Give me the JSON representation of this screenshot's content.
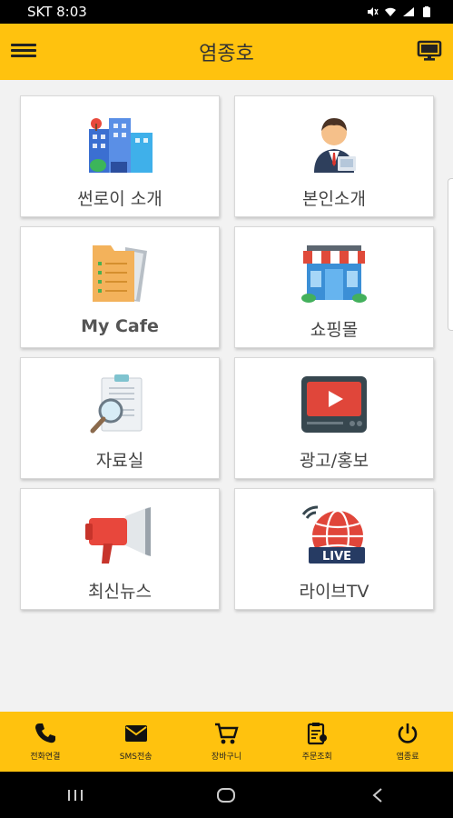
{
  "status": {
    "carrier_time": "SKT 8:03",
    "right": "4"
  },
  "app": {
    "title": "염종호"
  },
  "icons": {
    "menu": "menu-icon",
    "monitor": "monitor-icon"
  },
  "cards": [
    {
      "label": "썬로이 소개",
      "icon": "buildings-icon"
    },
    {
      "label": "본인소개",
      "icon": "businessman-icon"
    },
    {
      "label": "My Cafe",
      "icon": "folder-icon"
    },
    {
      "label": "쇼핑몰",
      "icon": "shop-icon"
    },
    {
      "label": "자료실",
      "icon": "document-search-icon"
    },
    {
      "label": "광고/홍보",
      "icon": "video-tv-icon"
    },
    {
      "label": "최신뉴스",
      "icon": "megaphone-icon"
    },
    {
      "label": "라이브TV",
      "icon": "live-globe-icon"
    }
  ],
  "bottom_nav": [
    {
      "label": "전화연결",
      "icon": "phone-icon"
    },
    {
      "label": "SMS전송",
      "icon": "mail-icon"
    },
    {
      "label": "장바구니",
      "icon": "cart-icon"
    },
    {
      "label": "주문조회",
      "icon": "order-icon"
    },
    {
      "label": "앱종료",
      "icon": "power-icon"
    }
  ],
  "colors": {
    "accent": "#FFC20E",
    "card_text": "#444444"
  }
}
